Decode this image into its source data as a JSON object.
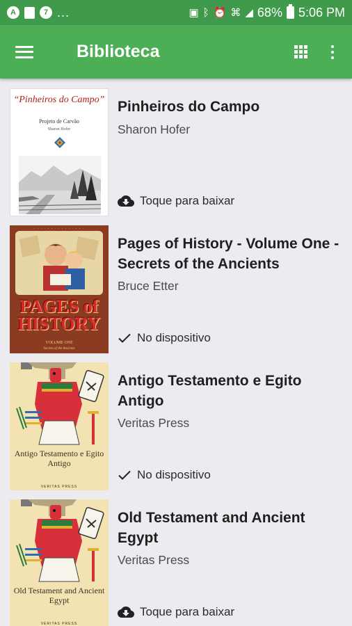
{
  "status_bar": {
    "left_icons": [
      "a-icon",
      "document-icon",
      "seven-icon"
    ],
    "left_more": "...",
    "right_icons": [
      "lock-icon",
      "bluetooth-icon",
      "alarm-icon",
      "hotspot-icon",
      "signal-icon"
    ],
    "battery_percent": "68%",
    "time": "5:06 PM"
  },
  "app_bar": {
    "title": "Biblioteca",
    "menu_icon": "hamburger-menu-icon",
    "grid_icon": "grid-view-icon",
    "more_icon": "more-vertical-icon"
  },
  "colors": {
    "status_bar": "#3f9a4c",
    "app_bar": "#4caf55",
    "background": "#ececf0"
  },
  "books": [
    {
      "title": "Pinheiros do Campo",
      "author": "Sharon Hofer",
      "status": "Toque para baixar",
      "status_icon": "cloud-download-icon",
      "cover": {
        "title": "“Pinheiros do Campo”",
        "subtitle": "Projeto de Carvão",
        "author": "Sharon Hofer"
      }
    },
    {
      "title": "Pages of History - Volume One - Secrets of the Ancients",
      "author": "Bruce Etter",
      "status": "No dispositivo",
      "status_icon": "check-icon",
      "cover": {
        "title": "PAGES of HISTORY",
        "subtitle": "VOLUME ONE",
        "subtitle2": "Secrets of the Ancients"
      }
    },
    {
      "title": "Antigo Testamento e Egito Antigo",
      "author": "Veritas Press",
      "status": "No dispositivo",
      "status_icon": "check-icon",
      "cover": {
        "title": "Antigo Testamento e Egito Antigo",
        "publisher": "VERITAS PRESS"
      }
    },
    {
      "title": "Old Testament and Ancient Egypt",
      "author": "Veritas Press",
      "status": "Toque para baixar",
      "status_icon": "cloud-download-icon",
      "cover": {
        "title": "Old Testament and Ancient Egypt",
        "publisher": "VERITAS PRESS"
      }
    }
  ]
}
